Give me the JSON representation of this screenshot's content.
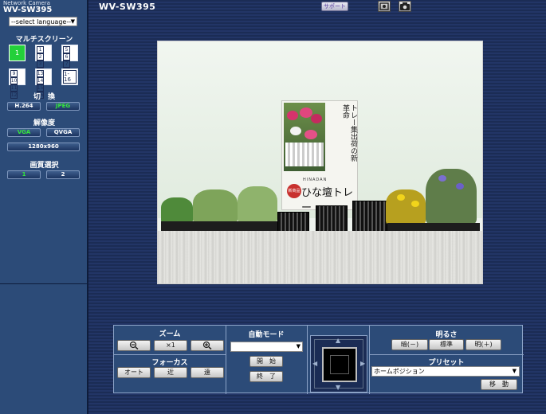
{
  "header": {
    "model_small": "Network Camera",
    "model_big": "WV-SW395",
    "title": "WV-SW395",
    "support_label": "サポート",
    "icons": [
      "snapshot-frame-icon",
      "camera-icon"
    ]
  },
  "sidebar": {
    "language": {
      "selected": "--select language--"
    },
    "multiscreen": {
      "title": "マルチスクリーン",
      "buttons": [
        {
          "cells": [
            "1"
          ],
          "active": true
        },
        {
          "cells": [
            "1",
            "2",
            "3",
            "4"
          ],
          "active": false
        },
        {
          "cells": [
            "5",
            "6",
            "7",
            "8"
          ],
          "active": false
        },
        {
          "cells": [
            "9",
            "10",
            "11",
            "12"
          ],
          "active": false
        },
        {
          "cells": [
            "13",
            "14",
            "15",
            "16"
          ],
          "active": false
        },
        {
          "cells": [
            "1-16"
          ],
          "active": false
        }
      ]
    },
    "switch": {
      "title": "切　換",
      "h264": "H.264",
      "jpeg": "JPEG"
    },
    "resolution": {
      "title": "解像度",
      "vga": "VGA",
      "qvga": "QVGA",
      "hd": "1280x960"
    },
    "quality": {
      "title": "画質選択",
      "q1": "1",
      "q2": "2"
    }
  },
  "camera": {
    "poster_text": "トレー集出荷の新革命",
    "poster_sub": "HINADAN",
    "poster_badge": "新商品",
    "poster_title": "ひな壇トレー"
  },
  "controls": {
    "zoom": {
      "title": "ズーム",
      "x1": "×1"
    },
    "focus": {
      "title": "フォーカス",
      "auto": "オート",
      "near": "近",
      "far": "遠"
    },
    "auto_mode": {
      "title": "自動モード",
      "value": "",
      "start": "開　始",
      "stop": "終　了"
    },
    "brightness": {
      "title": "明るさ",
      "dark": "暗(－)",
      "normal": "標準",
      "bright": "明(＋)"
    },
    "preset": {
      "title": "プリセット",
      "value": "ホームポジション",
      "move": "移　動"
    }
  },
  "colors": {
    "sidebar_bg": "#2c4b78",
    "active_green": "#23d03a",
    "text_green": "#34e63c"
  }
}
